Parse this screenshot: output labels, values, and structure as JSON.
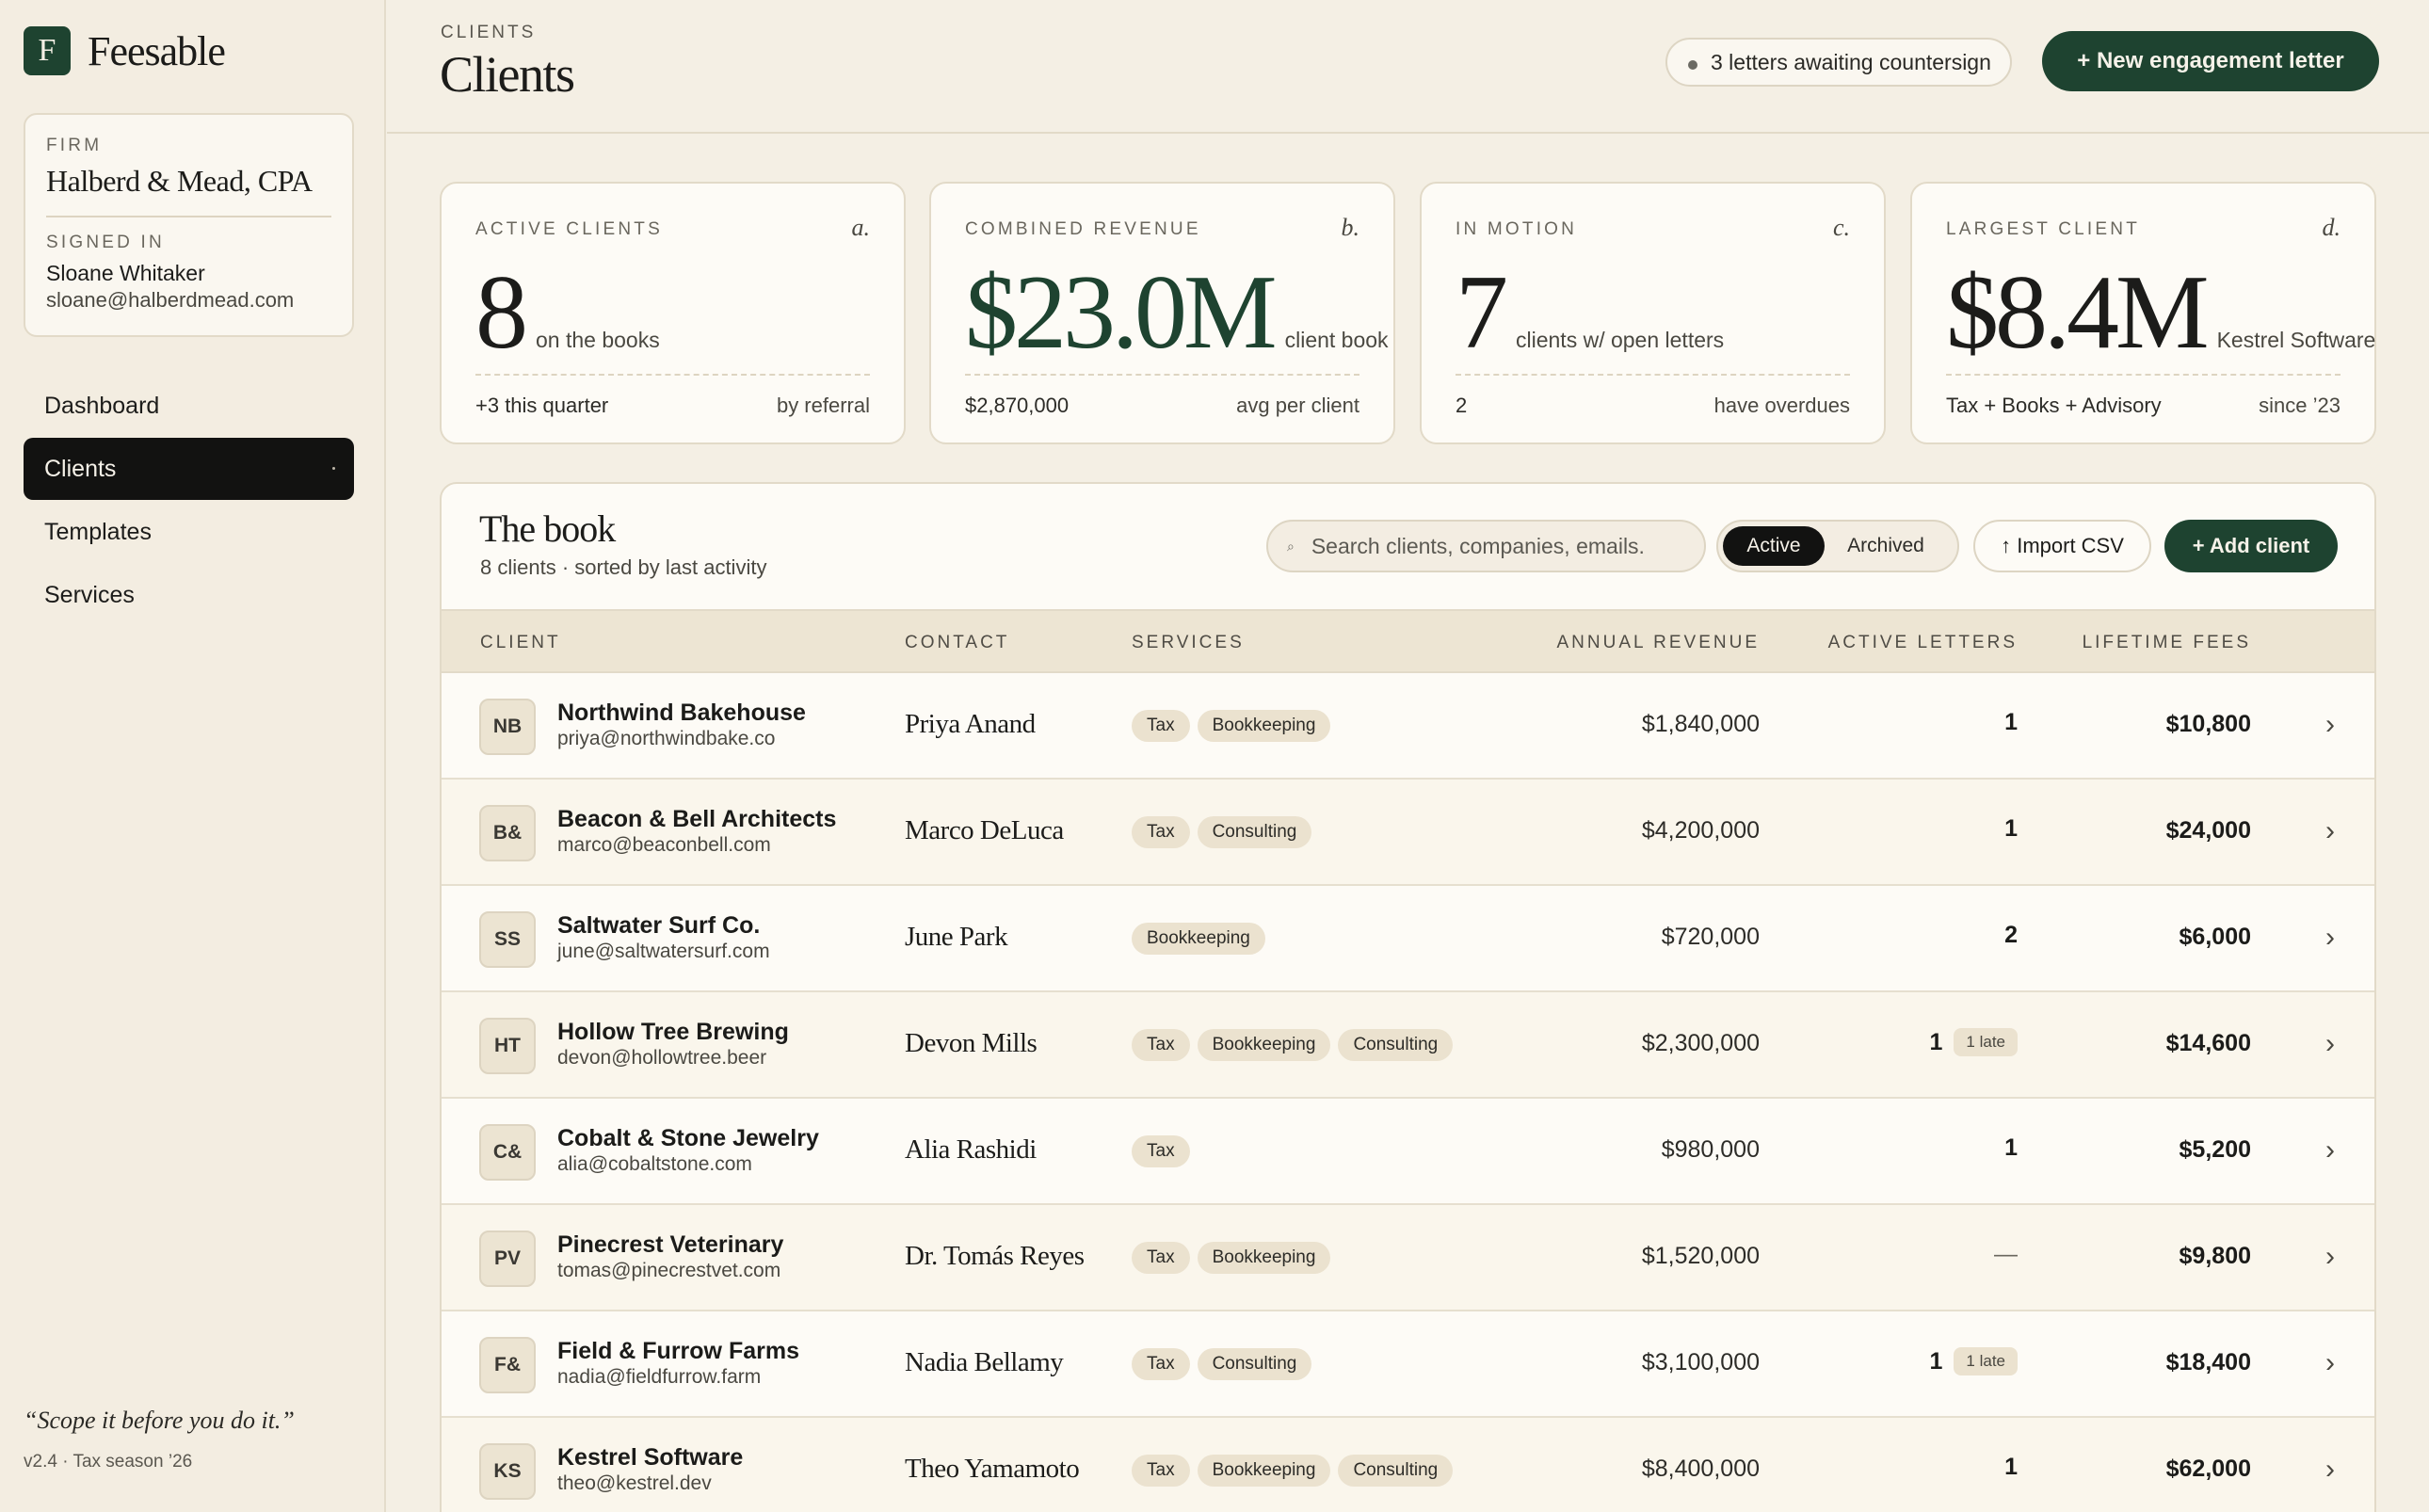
{
  "brand": {
    "mark": "F",
    "name": "Feesable"
  },
  "firm": {
    "label": "FIRM",
    "name": "Halberd & Mead, CPA",
    "signed_label": "SIGNED IN",
    "user_name": "Sloane Whitaker",
    "user_email": "sloane@halberdmead.com"
  },
  "nav": [
    {
      "label": "Dashboard"
    },
    {
      "label": "Clients"
    },
    {
      "label": "Templates"
    },
    {
      "label": "Services"
    }
  ],
  "footer": {
    "quote": "“Scope it before you do it.”",
    "version": "v2.4 · Tax season ’26"
  },
  "header": {
    "crumb": "CLIENTS",
    "title": "Clients",
    "awaiting": "3 letters awaiting countersign",
    "new_button": "+ New engagement letter"
  },
  "stats": [
    {
      "label": "ACTIVE CLIENTS",
      "letter": "a.",
      "big": "8",
      "big_sub": "on the books",
      "foot_left": "+3 this quarter",
      "foot_right": "by referral"
    },
    {
      "label": "COMBINED REVENUE",
      "letter": "b.",
      "big": "$23.0M",
      "big_sub": "client book",
      "foot_left": "$2,870,000",
      "foot_right": "avg per client"
    },
    {
      "label": "IN MOTION",
      "letter": "c.",
      "big": "7",
      "big_sub": "clients w/ open letters",
      "foot_left": "2",
      "foot_right": "have overdues"
    },
    {
      "label": "LARGEST CLIENT",
      "letter": "d.",
      "big": "$8.4M",
      "big_sub": "Kestrel Software",
      "foot_left": "Tax + Books + Advisory",
      "foot_right": "since ’23"
    }
  ],
  "book": {
    "title": "The book",
    "subtitle": "8 clients · sorted by last activity",
    "search_placeholder": "Search clients, companies, emails.",
    "filter_active": "Active",
    "filter_archived": "Archived",
    "import_label": "↑ Import CSV",
    "add_label": "+ Add client",
    "columns": [
      "CLIENT",
      "CONTACT",
      "SERVICES",
      "ANNUAL REVENUE",
      "ACTIVE LETTERS",
      "LIFETIME FEES"
    ],
    "rows": [
      {
        "initials": "NB",
        "name": "Northwind Bakehouse",
        "email": "priya@northwindbake.co",
        "contact": "Priya Anand",
        "services": [
          "Tax",
          "Bookkeeping"
        ],
        "revenue": "$1,840,000",
        "letters": "1",
        "late": "",
        "fees": "$10,800"
      },
      {
        "initials": "B&",
        "name": "Beacon & Bell Architects",
        "email": "marco@beaconbell.com",
        "contact": "Marco DeLuca",
        "services": [
          "Tax",
          "Consulting"
        ],
        "revenue": "$4,200,000",
        "letters": "1",
        "late": "",
        "fees": "$24,000"
      },
      {
        "initials": "SS",
        "name": "Saltwater Surf Co.",
        "email": "june@saltwatersurf.com",
        "contact": "June Park",
        "services": [
          "Bookkeeping"
        ],
        "revenue": "$720,000",
        "letters": "2",
        "late": "",
        "fees": "$6,000"
      },
      {
        "initials": "HT",
        "name": "Hollow Tree Brewing",
        "email": "devon@hollowtree.beer",
        "contact": "Devon Mills",
        "services": [
          "Tax",
          "Bookkeeping",
          "Consulting"
        ],
        "revenue": "$2,300,000",
        "letters": "1",
        "late": "1 late",
        "fees": "$14,600"
      },
      {
        "initials": "C&",
        "name": "Cobalt & Stone Jewelry",
        "email": "alia@cobaltstone.com",
        "contact": "Alia Rashidi",
        "services": [
          "Tax"
        ],
        "revenue": "$980,000",
        "letters": "1",
        "late": "",
        "fees": "$5,200"
      },
      {
        "initials": "PV",
        "name": "Pinecrest Veterinary",
        "email": "tomas@pinecrestvet.com",
        "contact": "Dr. Tomás Reyes",
        "services": [
          "Tax",
          "Bookkeeping"
        ],
        "revenue": "$1,520,000",
        "letters": "—",
        "late": "",
        "fees": "$9,800"
      },
      {
        "initials": "F&",
        "name": "Field & Furrow Farms",
        "email": "nadia@fieldfurrow.farm",
        "contact": "Nadia Bellamy",
        "services": [
          "Tax",
          "Consulting"
        ],
        "revenue": "$3,100,000",
        "letters": "1",
        "late": "1 late",
        "fees": "$18,400"
      },
      {
        "initials": "KS",
        "name": "Kestrel Software",
        "email": "theo@kestrel.dev",
        "contact": "Theo Yamamoto",
        "services": [
          "Tax",
          "Bookkeeping",
          "Consulting"
        ],
        "revenue": "$8,400,000",
        "letters": "1",
        "late": "",
        "fees": "$62,000"
      }
    ]
  },
  "colors": {
    "accent": "#1e4330",
    "background": "#f4efe4",
    "active_nav": "#121211"
  }
}
